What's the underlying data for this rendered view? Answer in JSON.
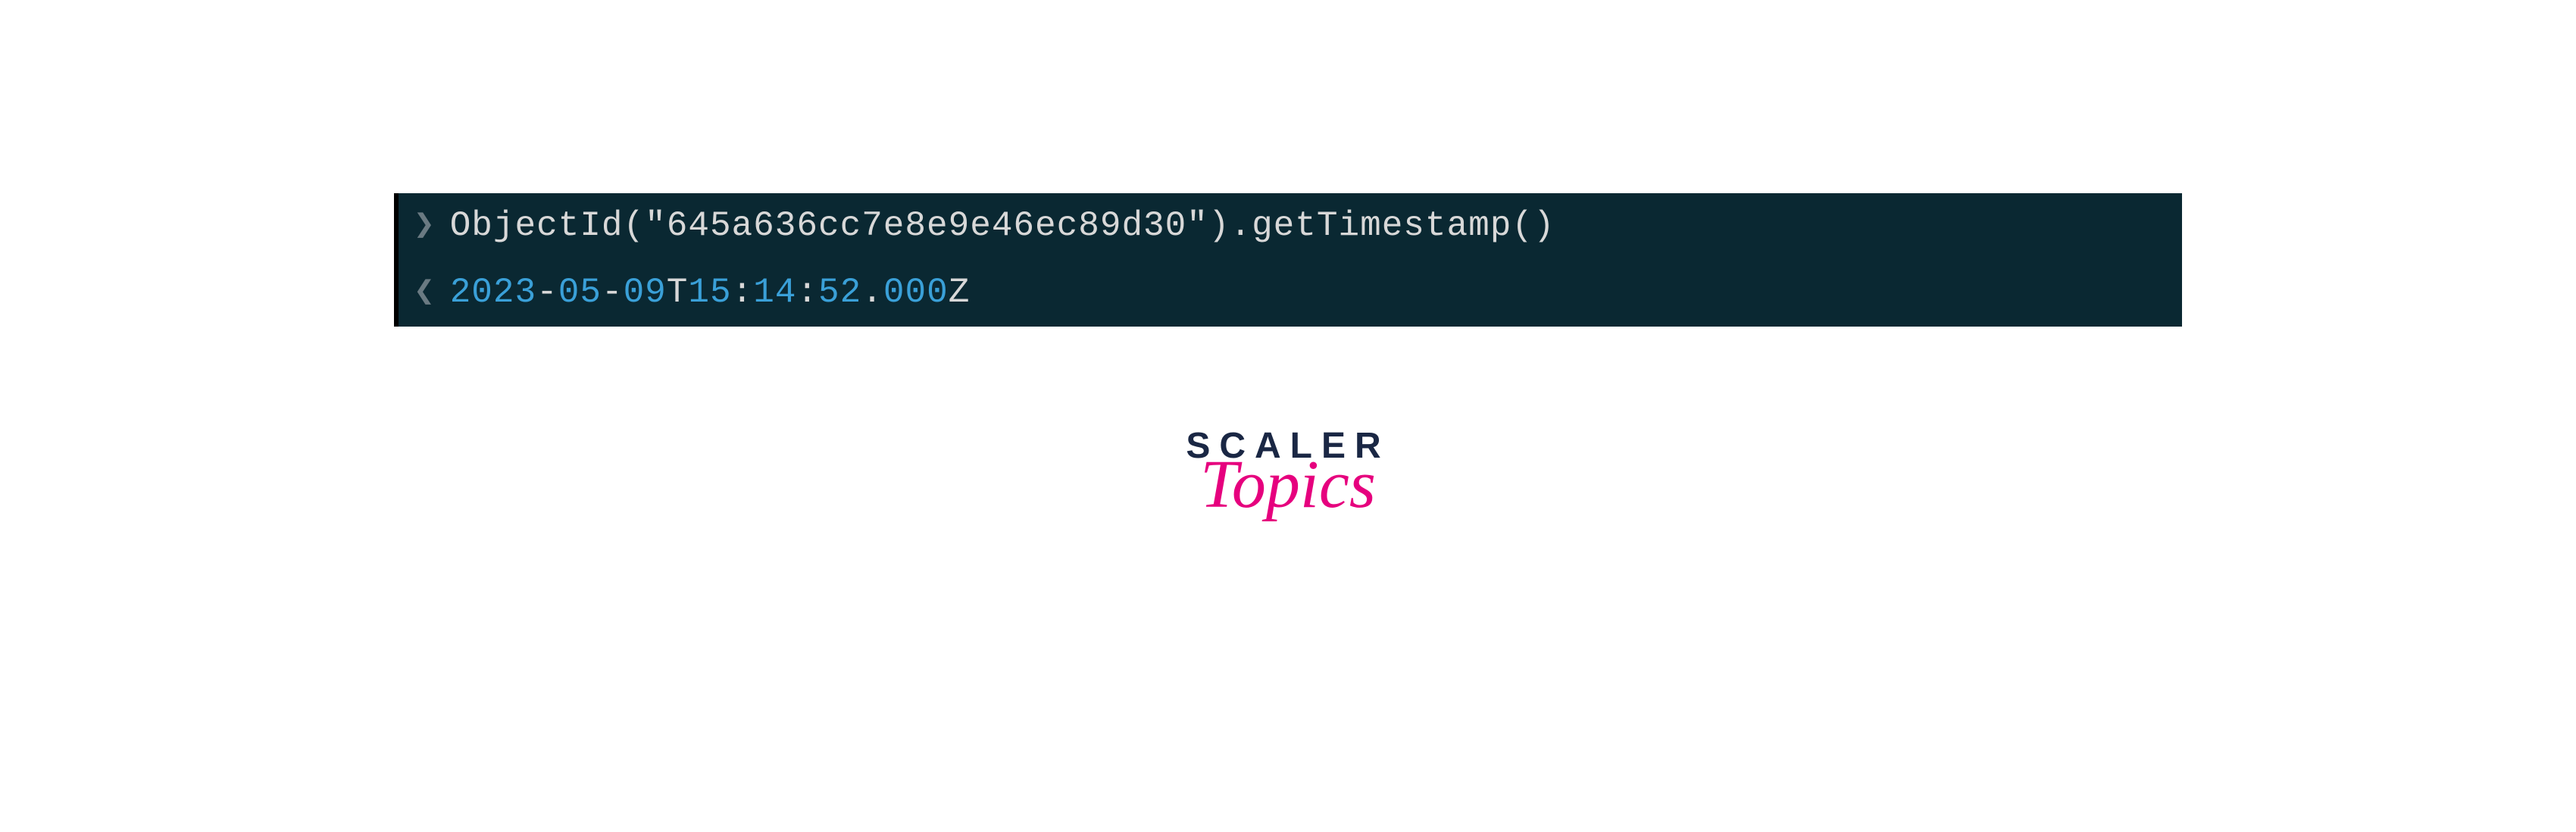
{
  "terminal": {
    "input": {
      "command": "ObjectId(\"645a636cc7e8e9e46ec89d30\").getTimestamp()"
    },
    "output": {
      "year": "2023",
      "month": "05",
      "day": "09",
      "hour": "15",
      "minute": "14",
      "second": "52",
      "millisecond": "000",
      "dash1": "-",
      "dash2": "-",
      "T": "T",
      "colon1": ":",
      "colon2": ":",
      "dot": ".",
      "Z": "Z"
    }
  },
  "logo": {
    "line1": "SCALER",
    "line2": "Topics"
  }
}
